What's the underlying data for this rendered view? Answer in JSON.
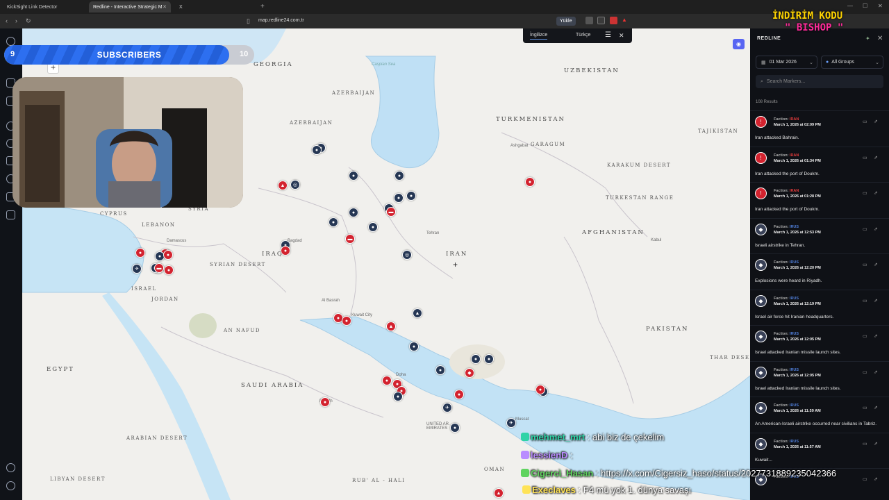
{
  "browser": {
    "tabs": [
      {
        "label": "KickSight Link Detector"
      },
      {
        "label": "Redline - Interactive Strategic M"
      },
      {
        "label": "X"
      }
    ],
    "url": "map.redline24.com.tr",
    "yukle": "Yükle"
  },
  "lang": {
    "english": "İngilizce",
    "turkish": "Türkçe"
  },
  "map": {
    "countries": [
      {
        "name": "UZBEKISTAN"
      },
      {
        "name": "TURKMENISTAN"
      },
      {
        "name": "AZERBAIJAN"
      },
      {
        "name": "AZERBAIJAN"
      },
      {
        "name": "IRAN"
      },
      {
        "name": "AFGHANISTAN"
      },
      {
        "name": "PAKISTAN"
      },
      {
        "name": "IRAQ"
      },
      {
        "name": "SYRIA"
      },
      {
        "name": "LEBANON"
      },
      {
        "name": "ISRAEL"
      },
      {
        "name": "JORDAN"
      },
      {
        "name": "EGYPT"
      },
      {
        "name": "SAUDI ARABIA"
      },
      {
        "name": "OMAN"
      },
      {
        "name": "UNITED AR. EMIRATES"
      },
      {
        "name": "GEORGIA"
      },
      {
        "name": "CYPRUS"
      },
      {
        "name": "TAJIKISTAN"
      }
    ],
    "regions": [
      {
        "name": "KARAKUM DESERT"
      },
      {
        "name": "SYRIAN DESERT"
      },
      {
        "name": "AN NAFUD"
      },
      {
        "name": "RUB' AL - HALI"
      },
      {
        "name": "ARABIAN DESERT"
      },
      {
        "name": "LIBYAN DESERT"
      },
      {
        "name": "GARAGUM"
      },
      {
        "name": "TURKESTAN RANGE"
      },
      {
        "name": "THAR DESERT"
      }
    ],
    "cities": [
      {
        "name": "Tehran"
      },
      {
        "name": "Bagdad"
      },
      {
        "name": "Riyadh"
      },
      {
        "name": "Al Basrah"
      },
      {
        "name": "Kuwait City"
      },
      {
        "name": "Doha"
      },
      {
        "name": "Muscat"
      },
      {
        "name": "Kabul"
      },
      {
        "name": "Damascus"
      },
      {
        "name": "Ashgabat"
      }
    ],
    "sea": {
      "name": "Caspian Sea"
    },
    "markers": [
      {
        "color": "blue",
        "glyph": "●"
      },
      {
        "color": "blue",
        "glyph": "●"
      },
      {
        "color": "red",
        "glyph": "▲"
      },
      {
        "color": "blue",
        "glyph": "◎"
      },
      {
        "color": "blue",
        "glyph": "●"
      },
      {
        "color": "blue",
        "glyph": "●"
      },
      {
        "color": "blue",
        "glyph": "●"
      },
      {
        "color": "blue",
        "glyph": "●"
      },
      {
        "color": "blue",
        "glyph": "●"
      },
      {
        "color": "blue",
        "glyph": "●"
      },
      {
        "color": "blue",
        "glyph": "●"
      },
      {
        "color": "blue",
        "glyph": "●"
      },
      {
        "color": "red",
        "glyph": "▬"
      },
      {
        "color": "blue",
        "glyph": "◎"
      },
      {
        "color": "red",
        "glyph": "▬"
      },
      {
        "color": "blue",
        "glyph": "●"
      },
      {
        "color": "red",
        "glyph": "●"
      },
      {
        "color": "red",
        "glyph": "●"
      },
      {
        "color": "blue",
        "glyph": "●"
      },
      {
        "color": "red",
        "glyph": "●"
      },
      {
        "color": "red",
        "glyph": "●"
      },
      {
        "color": "red",
        "glyph": "●"
      },
      {
        "color": "blue",
        "glyph": "✈"
      },
      {
        "color": "blue",
        "glyph": "✈"
      },
      {
        "color": "blue",
        "glyph": "◎"
      },
      {
        "color": "red",
        "glyph": "●"
      },
      {
        "color": "red",
        "glyph": "●"
      },
      {
        "color": "red",
        "glyph": "▲"
      },
      {
        "color": "blue",
        "glyph": "▲"
      },
      {
        "color": "blue",
        "glyph": "●"
      },
      {
        "color": "blue",
        "glyph": "●"
      },
      {
        "color": "blue",
        "glyph": "●"
      },
      {
        "color": "blue",
        "glyph": "●"
      },
      {
        "color": "red",
        "glyph": "◆"
      },
      {
        "color": "red",
        "glyph": "●"
      },
      {
        "color": "red",
        "glyph": "●"
      },
      {
        "color": "red",
        "glyph": "●"
      },
      {
        "color": "blue",
        "glyph": "●"
      },
      {
        "color": "red",
        "glyph": "●"
      },
      {
        "color": "red",
        "glyph": "●"
      },
      {
        "color": "red",
        "glyph": "●"
      },
      {
        "color": "blue",
        "glyph": "●"
      },
      {
        "color": "blue",
        "glyph": "✈"
      },
      {
        "color": "blue",
        "glyph": "✈"
      },
      {
        "color": "blue",
        "glyph": "●"
      },
      {
        "color": "red",
        "glyph": "▲"
      },
      {
        "color": "red",
        "glyph": "●"
      },
      {
        "color": "red",
        "glyph": "▬"
      }
    ]
  },
  "sidebar": {
    "title": "REDLINE",
    "date": "01 Mar 2026",
    "groups": "All Groups",
    "search_placeholder": "Search Markers...",
    "results": "108 Results",
    "faction_label": "Faction:",
    "events": [
      {
        "faction": "IRAN",
        "fcolor": "#e23b3b",
        "icon": "red",
        "date": "March 1, 2026 at 02:09 PM",
        "text": "Iran attacked Bahrain."
      },
      {
        "faction": "IRAN",
        "fcolor": "#e23b3b",
        "icon": "red",
        "date": "March 1, 2026 at 01:34 PM",
        "text": "Iran attacked the port of Doukm."
      },
      {
        "faction": "IRAN",
        "fcolor": "#e23b3b",
        "icon": "red",
        "date": "March 1, 2026 at 01:28 PM",
        "text": "Iran attacked the port of Doukm."
      },
      {
        "faction": "IRUS",
        "fcolor": "#4f7ed8",
        "icon": "blue",
        "date": "March 1, 2026 at 12:53 PM",
        "text": "Israeli airstrike in Tehran."
      },
      {
        "faction": "IRUS",
        "fcolor": "#4f7ed8",
        "icon": "blue",
        "date": "March 1, 2026 at 12:20 PM",
        "text": "Explosions were heard in Riyadh."
      },
      {
        "faction": "IRUS",
        "fcolor": "#4f7ed8",
        "icon": "blue",
        "date": "March 1, 2026 at 12:19 PM",
        "text": "Israel air force hit Iranian headquarters."
      },
      {
        "faction": "IRUS",
        "fcolor": "#4f7ed8",
        "icon": "blue",
        "date": "March 1, 2026 at 12:05 PM",
        "text": "Israel attacked Iranian missile launch sites."
      },
      {
        "faction": "IRUS",
        "fcolor": "#4f7ed8",
        "icon": "blue",
        "date": "March 1, 2026 at 12:05 PM",
        "text": "Israel attacked Iranian missile launch sites."
      },
      {
        "faction": "IRUS",
        "fcolor": "#4f7ed8",
        "icon": "blue",
        "date": "March 1, 2026 at 11:59 AM",
        "text": "An American-Israeli airstrike occurred near civilians in Tabriz."
      },
      {
        "faction": "IRUS",
        "fcolor": "#4f7ed8",
        "icon": "blue",
        "date": "March 1, 2026 at 11:57 AM",
        "text": "Kuwait..."
      },
      {
        "faction": "IRUS",
        "fcolor": "#4f7ed8",
        "icon": "blue",
        "date": "",
        "text": ""
      }
    ]
  },
  "overlay": {
    "subs_label": "SUBSCRIBERS",
    "subs_current": "9",
    "subs_goal": "10",
    "subs_progress": 0.9,
    "promo_line1": "İNDİRİM KODU",
    "promo_line2": "\" BISHOP \"",
    "chat": [
      {
        "user": "mehmet_mrt",
        "ucolor": "#2fd3a7",
        "text": ": abi biz de çekelim"
      },
      {
        "user": "lessienD",
        "ucolor": "#b98bff",
        "text": ":"
      },
      {
        "user": "Cigerci_Hasan",
        "ucolor": "#5fd35f",
        "text": ": https://x.com/Cigersiz_haso/status/2027731889235042366"
      },
      {
        "user": "Execlaves",
        "ucolor": "#ffe357",
        "text": ": F4 mü yok 1. dünya savaşı"
      }
    ]
  }
}
